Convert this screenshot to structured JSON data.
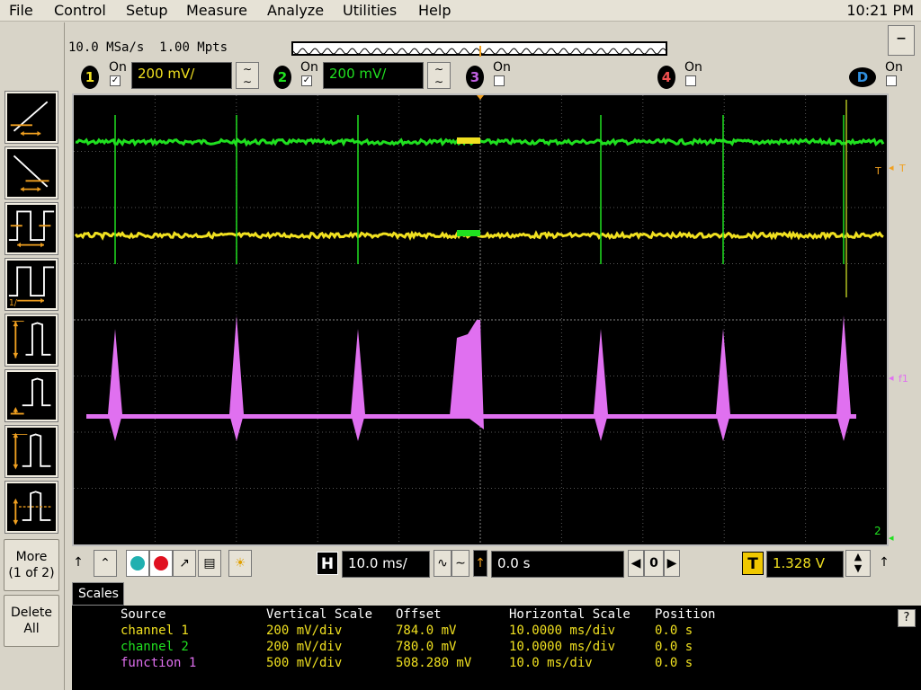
{
  "menu": {
    "items": [
      "File",
      "Control",
      "Setup",
      "Measure",
      "Analyze",
      "Utilities",
      "Help"
    ],
    "clock": "10:21 PM"
  },
  "acquisition": {
    "sample_rate": "10.0 MSa/s",
    "memory": "1.00 Mpts"
  },
  "minimize_label": "–",
  "channels": [
    {
      "number": "1",
      "on_label": "On",
      "checked": true,
      "scale": "200 mV/",
      "color": "#f0e020"
    },
    {
      "number": "2",
      "on_label": "On",
      "checked": true,
      "scale": "200 mV/",
      "color": "#20e020"
    },
    {
      "number": "3",
      "on_label": "On",
      "checked": false,
      "color": "#c060e0"
    },
    {
      "number": "4",
      "on_label": "On",
      "checked": false,
      "color": "#f05050"
    },
    {
      "number": "D",
      "on_label": "On",
      "checked": false,
      "color": "#3090e0"
    }
  ],
  "left_panel": {
    "more_label": "More",
    "more_sub": "(1 of 2)",
    "delete_label": "Delete",
    "delete_sub": "All"
  },
  "markers": {
    "trigger": "T",
    "function": "f1",
    "channel": "2"
  },
  "toolbar": {
    "h_label": "H",
    "time_scale": "10.0 ms/",
    "delay": "0.0 s",
    "zero_label": "0",
    "t_label": "T",
    "trigger_level": "1.328 V"
  },
  "scales_tab": "Scales",
  "scales_table": {
    "headers": [
      "Source",
      "Vertical Scale",
      "Offset",
      "Horizontal Scale",
      "Position"
    ],
    "rows": [
      {
        "source": "channel 1",
        "vscale": "200 mV/div",
        "offset": "784.0 mV",
        "hscale": "10.0000 ms/div",
        "position": "0.0 s",
        "color": "#f0e020"
      },
      {
        "source": "channel 2",
        "vscale": "200 mV/div",
        "offset": "780.0 mV",
        "hscale": "10.0000 ms/div",
        "position": "0.0 s",
        "color": "#20e020"
      },
      {
        "source": "function 1",
        "vscale": "500 mV/div",
        "offset": "508.280 mV",
        "hscale": "10.0 ms/div",
        "position": "0.0 s",
        "color": "#e070f0"
      }
    ]
  },
  "help_label": "?",
  "colors": {
    "ch1": "#f0e020",
    "ch2": "#20e020",
    "function": "#e070f0",
    "marker": "#f0a020"
  }
}
